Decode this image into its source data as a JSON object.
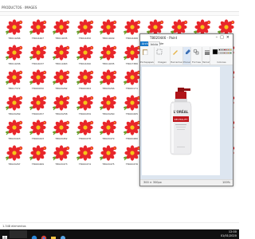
{
  "explorer": {
    "breadcrumb": [
      "PRODUCTOS",
      "IMAGES"
    ],
    "thumb_colors": {
      "petal": "#e8262b",
      "center": "#f5c518",
      "leaf": "#6a9f2c"
    },
    "thumbs_visible": [
      {
        "label": "T8014266",
        "selected": false
      },
      {
        "label": "T8014467",
        "selected": false
      },
      {
        "label": "T8014035",
        "selected": false
      },
      {
        "label": "T8014450",
        "selected": false
      },
      {
        "label": "T8014049",
        "selected": false
      },
      {
        "label": "T8014266",
        "selected": false
      },
      {
        "label": "T8014467",
        "selected": false
      },
      {
        "label": "T8014035",
        "selected": false
      },
      {
        "label": "T8014450",
        "selected": false
      },
      {
        "label": "T8014049",
        "selected": false
      },
      {
        "label": "T8014206",
        "selected": false
      },
      {
        "label": "T8014037",
        "selected": false
      },
      {
        "label": "T8014463",
        "selected": false
      },
      {
        "label": "T8014290",
        "selected": false
      },
      {
        "label": "T8014035",
        "selected": false
      },
      {
        "label": "T8017380",
        "selected": false
      },
      {
        "label": "T8017380",
        "selected": false
      },
      {
        "label": "T8017380",
        "selected": false
      },
      {
        "label": "T8017382",
        "selected": false
      },
      {
        "label": "T8014266",
        "selected": false
      },
      {
        "label": "T8017372",
        "selected": false
      },
      {
        "label": "T8020050",
        "selected": false
      },
      {
        "label": "T8020262",
        "selected": false
      },
      {
        "label": "T8020264",
        "selected": false
      },
      {
        "label": "T8020266",
        "selected": false
      },
      {
        "label": "T8020171",
        "selected": false
      },
      {
        "label": "T8020175",
        "selected": false
      },
      {
        "label": "T8021363",
        "selected": false
      },
      {
        "label": "T8020265",
        "selected": false
      },
      {
        "label": "T8020265",
        "selected": false
      },
      {
        "label": "T8020269",
        "selected": false
      },
      {
        "label": "T8020257",
        "selected": false
      },
      {
        "label": "T8020258",
        "selected": false
      },
      {
        "label": "T8020259",
        "selected": false
      },
      {
        "label": "T8020260",
        "selected": false
      },
      {
        "label": "T8020265",
        "selected": false
      },
      {
        "label": "T8020276",
        "selected": false
      },
      {
        "label": "T8020265",
        "selected": false
      },
      {
        "label": "T8020265",
        "selected": false
      },
      {
        "label": "T8020265",
        "selected": false
      },
      {
        "label": "T8020443",
        "selected": false
      },
      {
        "label": "T8020443",
        "selected": false
      },
      {
        "label": "T8020452",
        "selected": false
      },
      {
        "label": "T8020478",
        "selected": false
      },
      {
        "label": "T8020479",
        "selected": false
      },
      {
        "label": "T8020480",
        "selected": false
      },
      {
        "label": "T8020481",
        "selected": false
      },
      {
        "label": "T8020453",
        "selected": false
      },
      {
        "label": "T8020457",
        "selected": false
      },
      {
        "label": "T8020457",
        "selected": false
      },
      {
        "label": "T8020267",
        "selected": false
      },
      {
        "label": "T8020469",
        "selected": false
      },
      {
        "label": "T8020473",
        "selected": false
      },
      {
        "label": "T8020474",
        "selected": false
      },
      {
        "label": "T8020475",
        "selected": false
      },
      {
        "label": "T8020476",
        "selected": false
      },
      {
        "label": "T8020477",
        "selected": false
      },
      {
        "label": "T8020446",
        "selected": true
      },
      {
        "label": "T8020447",
        "selected": false
      },
      {
        "label": "T8020448",
        "selected": false
      }
    ],
    "status_count": "1.348 elementos"
  },
  "paint": {
    "title": "T8020446 - Paint",
    "tabs": [
      "Archivo",
      "Inicio",
      "Ver"
    ],
    "groups": [
      "Portapapeles",
      "Imagen",
      "Herramientas",
      "Pinceles",
      "Formas",
      "Tamaño",
      "Colores"
    ],
    "status_dims": "300 × 300px",
    "zoom": "100%",
    "product_brand": "L'ORÉAL",
    "product_name": "REVITALIFT",
    "colors": {
      "bottle": "#e8e8ea",
      "cap": "#b01318",
      "label": "#c0171d"
    }
  },
  "taskbar": {
    "time": "12:00",
    "date": "01/01/2020"
  }
}
